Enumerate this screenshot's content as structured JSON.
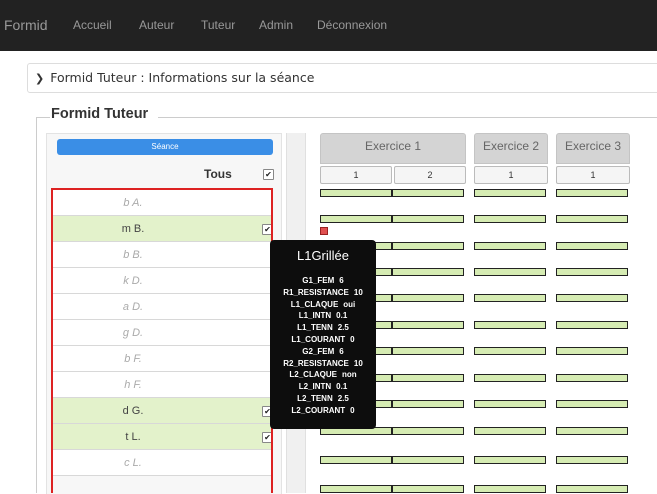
{
  "nav": {
    "brand": "Formid",
    "items": [
      "Accueil",
      "Auteur",
      "Tuteur",
      "Admin",
      "Déconnexion"
    ]
  },
  "breadcrumb": "Formid Tuteur : Informations sur la séance",
  "fieldset_legend": "Formid Tuteur",
  "left": {
    "seance_button": "Séance",
    "tous_label": "Tous",
    "tous_checked": true,
    "students": [
      {
        "name": "b A.",
        "selected": false
      },
      {
        "name": "m B.",
        "selected": true
      },
      {
        "name": "b B.",
        "selected": false
      },
      {
        "name": "k D.",
        "selected": false
      },
      {
        "name": "a D.",
        "selected": false
      },
      {
        "name": "g D.",
        "selected": false
      },
      {
        "name": "b F.",
        "selected": false
      },
      {
        "name": "h F.",
        "selected": false
      },
      {
        "name": "d G.",
        "selected": true
      },
      {
        "name": "t L.",
        "selected": true
      },
      {
        "name": "c L.",
        "selected": false
      }
    ]
  },
  "exercises": [
    {
      "label": "Exercice 1",
      "questions": [
        "1",
        "2"
      ]
    },
    {
      "label": "Exercice 2",
      "questions": [
        "1"
      ]
    },
    {
      "label": "Exercice 3",
      "questions": [
        "1"
      ]
    }
  ],
  "tooltip": {
    "title": "L1Grillée",
    "rows": [
      {
        "key": "G1_FEM",
        "value": "6"
      },
      {
        "key": "R1_RESISTANCE",
        "value": "10"
      },
      {
        "key": "L1_CLAQUE",
        "value": "oui"
      },
      {
        "key": "L1_INTN",
        "value": "0.1"
      },
      {
        "key": "L1_TENN",
        "value": "2.5"
      },
      {
        "key": "L1_COURANT",
        "value": "0"
      },
      {
        "key": "G2_FEM",
        "value": "6"
      },
      {
        "key": "R2_RESISTANCE",
        "value": "10"
      },
      {
        "key": "L2_CLAQUE",
        "value": "non"
      },
      {
        "key": "L2_INTN",
        "value": "0.1"
      },
      {
        "key": "L2_TENN",
        "value": "2.5"
      },
      {
        "key": "L2_COURANT",
        "value": "0"
      }
    ]
  },
  "colors": {
    "navbar": "#222222",
    "accent": "#3a8ee6",
    "selected_row": "#e3f2cb",
    "cell_fill": "#d6ecb3",
    "student_border": "#dd2222",
    "mark": "#e05050"
  }
}
